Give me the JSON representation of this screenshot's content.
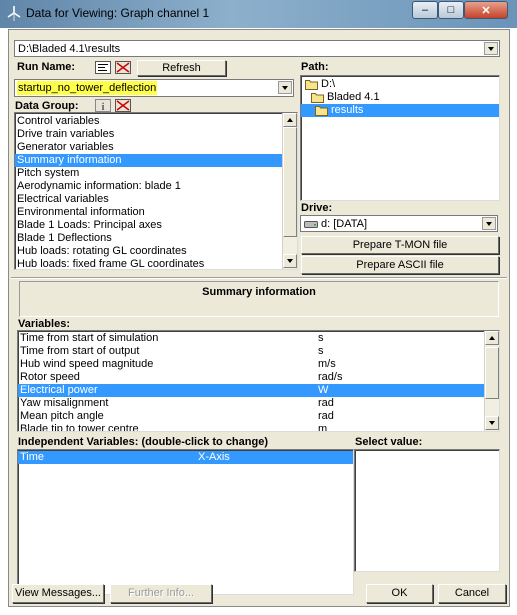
{
  "window": {
    "title": "Data for Viewing: Graph channel 1"
  },
  "results_path": "D:\\Bladed 4.1\\results",
  "run_name": {
    "label": "Run Name:",
    "refresh_label": "Refresh",
    "value": "startup_no_tower_deflection"
  },
  "path": {
    "label": "Path:",
    "items": [
      {
        "label": "D:\\",
        "selected": false
      },
      {
        "label": "Bladed 4.1",
        "selected": false
      },
      {
        "label": "results",
        "selected": true
      }
    ]
  },
  "data_group": {
    "label": "Data Group:",
    "items": [
      {
        "label": "Control variables"
      },
      {
        "label": "Drive train variables"
      },
      {
        "label": "Generator variables"
      },
      {
        "label": "Summary information",
        "selected": true
      },
      {
        "label": "Pitch system"
      },
      {
        "label": "Aerodynamic information: blade 1"
      },
      {
        "label": "Electrical variables"
      },
      {
        "label": "Environmental information"
      },
      {
        "label": "Blade 1 Loads: Principal axes"
      },
      {
        "label": "Blade 1 Deflections"
      },
      {
        "label": "Hub loads: rotating GL coordinates"
      },
      {
        "label": "Hub loads: fixed frame GL coordinates"
      }
    ]
  },
  "drive": {
    "label": "Drive:",
    "value": "d: [DATA]"
  },
  "buttons": {
    "tmon": "Prepare T-MON file",
    "ascii": "Prepare ASCII file",
    "view_messages": "View Messages...",
    "further_info": "Further Info...",
    "ok": "OK",
    "cancel": "Cancel"
  },
  "summary_title": "Summary information",
  "variables": {
    "label": "Variables:",
    "rows": [
      {
        "name": "Time from start of simulation",
        "unit": "s"
      },
      {
        "name": "Time from start of output",
        "unit": "s"
      },
      {
        "name": "Hub wind speed magnitude",
        "unit": "m/s"
      },
      {
        "name": "Rotor speed",
        "unit": "rad/s"
      },
      {
        "name": "Electrical power",
        "unit": "W",
        "selected": true
      },
      {
        "name": "Yaw misalignment",
        "unit": "rad"
      },
      {
        "name": "Mean pitch angle",
        "unit": "rad"
      },
      {
        "name": "Blade tip to tower centre",
        "unit": "m"
      }
    ]
  },
  "independent": {
    "label": "Independent Variables: (double-click to change)",
    "rows": [
      {
        "name": "Time",
        "axis": "X-Axis",
        "selected": true
      }
    ]
  },
  "select_value": {
    "label": "Select value:"
  },
  "colors": {
    "selection": "#3399ff",
    "highlight": "#ffff4a",
    "face": "#ece9d8"
  }
}
